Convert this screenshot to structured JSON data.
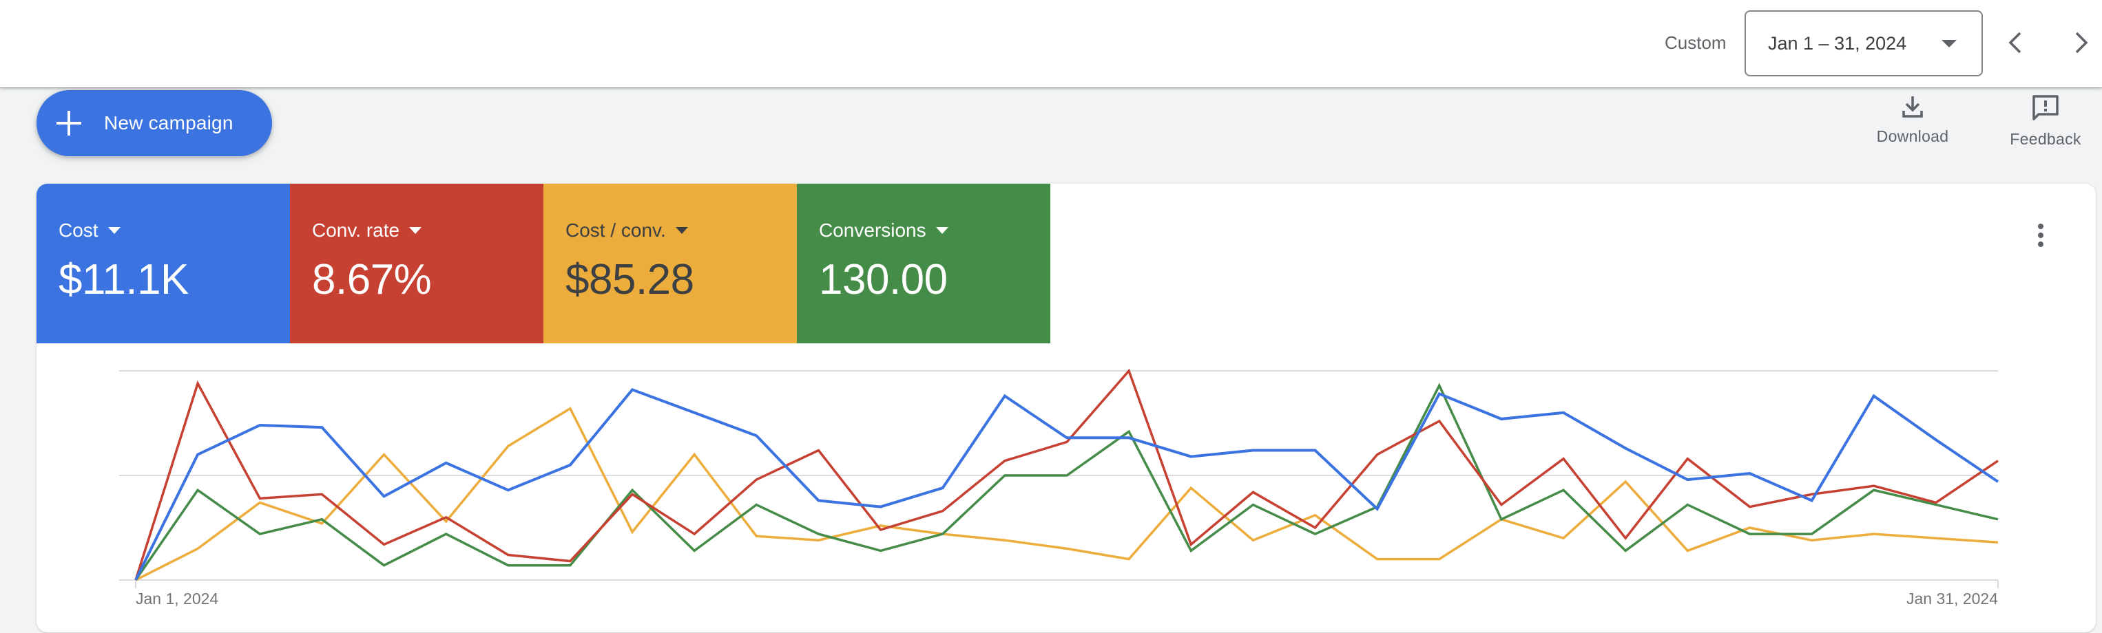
{
  "header": {
    "range_label": "Custom",
    "date_range": "Jan 1 – 31, 2024",
    "prev_icon": "chevron-left-icon",
    "next_icon": "chevron-right-icon"
  },
  "toolbar": {
    "new_campaign_label": "New campaign",
    "download_label": "Download",
    "feedback_label": "Feedback"
  },
  "metrics": [
    {
      "label": "Cost",
      "value": "$11.1K",
      "color": "#3b73e0"
    },
    {
      "label": "Conv. rate",
      "value": "8.67%",
      "color": "#c74132"
    },
    {
      "label": "Cost / conv.",
      "value": "$85.28",
      "color": "#edad3c"
    },
    {
      "label": "Conversions",
      "value": "130.00",
      "color": "#468c49"
    }
  ],
  "chart_data": {
    "type": "line",
    "title": "",
    "xlabel": "",
    "ylabel": "",
    "x_tick_labels": [
      "Jan 1, 2024",
      "Jan 31, 2024"
    ],
    "x": [
      "Jan 1",
      "Jan 2",
      "Jan 3",
      "Jan 4",
      "Jan 5",
      "Jan 6",
      "Jan 7",
      "Jan 8",
      "Jan 9",
      "Jan 10",
      "Jan 11",
      "Jan 12",
      "Jan 13",
      "Jan 14",
      "Jan 15",
      "Jan 16",
      "Jan 17",
      "Jan 18",
      "Jan 19",
      "Jan 20",
      "Jan 21",
      "Jan 22",
      "Jan 23",
      "Jan 24",
      "Jan 25",
      "Jan 26",
      "Jan 27",
      "Jan 28",
      "Jan 29",
      "Jan 30",
      "Jan 31"
    ],
    "ylim": [
      0,
      1
    ],
    "y_note": "No y-axis labels shown; values normalized per plot height (0 = baseline, 1 = top gridline)",
    "gridlines": [
      0,
      0.5,
      1
    ],
    "grid": true,
    "legend": "none",
    "series": [
      {
        "name": "Cost",
        "color": "#3b73e0",
        "values": [
          0.0,
          0.6,
          0.74,
          0.73,
          0.4,
          0.56,
          0.43,
          0.55,
          0.91,
          0.8,
          0.69,
          0.38,
          0.35,
          0.44,
          0.88,
          0.68,
          0.68,
          0.59,
          0.62,
          0.62,
          0.34,
          0.89,
          0.77,
          0.8,
          0.63,
          0.48,
          0.51,
          0.38,
          0.88,
          0.67,
          0.47
        ]
      },
      {
        "name": "Conv. rate",
        "color": "#c74132",
        "values": [
          0.0,
          0.94,
          0.39,
          0.41,
          0.17,
          0.3,
          0.12,
          0.09,
          0.41,
          0.22,
          0.48,
          0.62,
          0.24,
          0.33,
          0.57,
          0.66,
          1.0,
          0.17,
          0.42,
          0.25,
          0.6,
          0.76,
          0.36,
          0.58,
          0.2,
          0.58,
          0.35,
          0.41,
          0.45,
          0.37,
          0.57
        ]
      },
      {
        "name": "Cost / conv.",
        "color": "#edad3c",
        "values": [
          0.0,
          0.15,
          0.37,
          0.27,
          0.6,
          0.28,
          0.64,
          0.82,
          0.23,
          0.6,
          0.21,
          0.19,
          0.26,
          0.22,
          0.19,
          0.15,
          0.1,
          0.44,
          0.19,
          0.31,
          0.1,
          0.1,
          0.29,
          0.2,
          0.47,
          0.14,
          0.25,
          0.19,
          0.22,
          0.2,
          0.18
        ]
      },
      {
        "name": "Conversions",
        "color": "#468c49",
        "values": [
          0.0,
          0.43,
          0.22,
          0.29,
          0.07,
          0.22,
          0.07,
          0.07,
          0.43,
          0.14,
          0.36,
          0.22,
          0.14,
          0.22,
          0.5,
          0.5,
          0.71,
          0.14,
          0.36,
          0.22,
          0.35,
          0.93,
          0.29,
          0.43,
          0.14,
          0.36,
          0.22,
          0.22,
          0.43,
          0.36,
          0.29
        ]
      }
    ]
  }
}
